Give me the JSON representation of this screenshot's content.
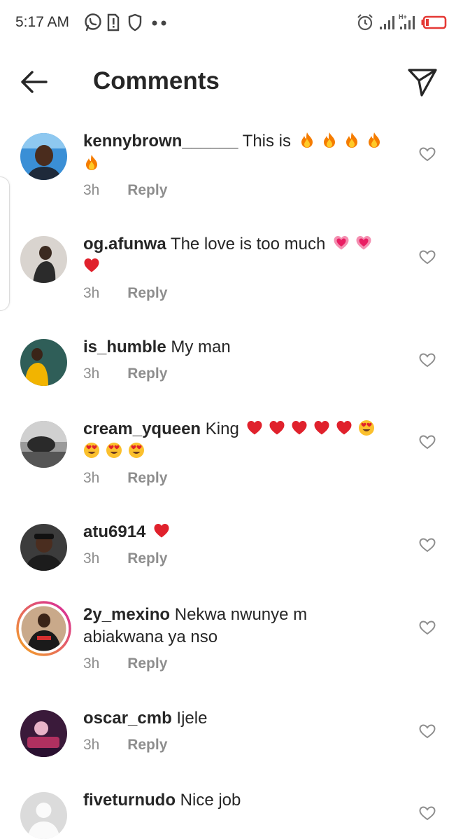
{
  "status_bar": {
    "time": "5:17 AM",
    "left_icons": [
      "whatsapp-icon",
      "sim-alert-icon",
      "shield-icon",
      "more-dots-icon"
    ],
    "right_icons": [
      "alarm-icon",
      "signal-icon",
      "signal-hplus-icon",
      "battery-low-icon"
    ],
    "battery_color": "#e53935"
  },
  "header": {
    "title": "Comments",
    "back_icon": "arrow-left-icon",
    "share_icon": "paper-plane-icon"
  },
  "comments": [
    {
      "username": "kennybrown______",
      "text": "This is",
      "emojis": [
        "fire",
        "fire",
        "fire",
        "fire",
        "fire"
      ],
      "time": "3h",
      "reply": "Reply"
    },
    {
      "username": "og.afunwa",
      "text": "The love is too much",
      "emojis": [
        "sparkling-heart",
        "sparkling-heart",
        "red-heart"
      ],
      "time": "3h",
      "reply": "Reply"
    },
    {
      "username": "is_humble",
      "text": "My man",
      "emojis": [],
      "time": "3h",
      "reply": "Reply"
    },
    {
      "username": "cream_yqueen",
      "text": "King",
      "emojis": [
        "red-heart",
        "red-heart",
        "red-heart",
        "red-heart",
        "red-heart",
        "heart-eyes",
        "heart-eyes",
        "heart-eyes",
        "heart-eyes"
      ],
      "time": "3h",
      "reply": "Reply"
    },
    {
      "username": "atu6914",
      "text": "",
      "emojis": [
        "red-heart"
      ],
      "time": "3h",
      "reply": "Reply"
    },
    {
      "username": "2y_mexino",
      "text": "Nekwa nwunye m abiakwana ya nso",
      "emojis": [],
      "time": "3h",
      "reply": "Reply",
      "story_ring": true
    },
    {
      "username": "oscar_cmb",
      "text": "Ijele",
      "emojis": [],
      "time": "3h",
      "reply": "Reply"
    },
    {
      "username": "fiveturnudo",
      "text": "Nice job",
      "emojis": [],
      "time": "",
      "reply": ""
    }
  ],
  "colors": {
    "text": "#262626",
    "meta": "#8e8e8e",
    "heart": "#e0212c",
    "story_ring_start": "#f5a623",
    "story_ring_end": "#d6249f"
  }
}
